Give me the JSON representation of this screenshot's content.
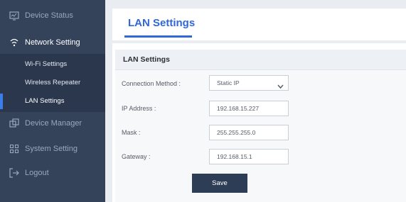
{
  "sidebar": {
    "items": [
      {
        "label": "Device Status",
        "icon": "monitor-icon"
      },
      {
        "label": "Network Setting",
        "icon": "wifi-icon"
      },
      {
        "label": "Device Manager",
        "icon": "devices-icon"
      },
      {
        "label": "System Setting",
        "icon": "settings-grid-icon"
      },
      {
        "label": "Logout",
        "icon": "logout-icon"
      }
    ],
    "submenu": [
      {
        "label": "Wi-Fi Settings"
      },
      {
        "label": "Wireless Repeater"
      },
      {
        "label": "LAN Settings"
      }
    ]
  },
  "page": {
    "tab_title": "LAN Settings",
    "panel_title": "LAN Settings"
  },
  "form": {
    "connection_method_label": "Connection Method :",
    "connection_method_value": "Static IP",
    "ip_label": "IP Address :",
    "ip_value": "192.168.15.227",
    "mask_label": "Mask :",
    "mask_value": "255.255.255.0",
    "gateway_label": "Gateway :",
    "gateway_value": "192.168.15.1",
    "save_label": "Save"
  },
  "colors": {
    "sidebar_bg": "#34425a",
    "accent": "#2f67d8",
    "button_bg": "#2e3d56"
  }
}
